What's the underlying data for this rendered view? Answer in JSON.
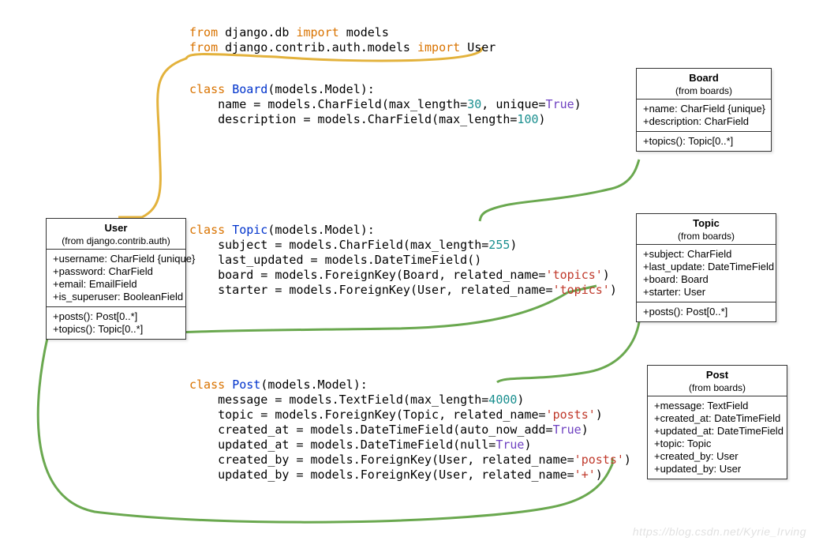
{
  "code": {
    "imports": [
      [
        {
          "t": "from ",
          "c": "kw-orange"
        },
        {
          "t": "django.db ",
          "c": ""
        },
        {
          "t": "import ",
          "c": "kw-orange"
        },
        {
          "t": "models",
          "c": ""
        }
      ],
      [
        {
          "t": "from ",
          "c": "kw-orange"
        },
        {
          "t": "django.contrib.auth.models ",
          "c": ""
        },
        {
          "t": "import ",
          "c": "kw-orange"
        },
        {
          "t": "User",
          "c": ""
        }
      ]
    ],
    "board": [
      [
        {
          "t": "class ",
          "c": "kw-orange"
        },
        {
          "t": "Board",
          "c": "kw-blue"
        },
        {
          "t": "(models.Model):",
          "c": ""
        }
      ],
      [
        {
          "t": "    name = models.CharField(max_length=",
          "c": ""
        },
        {
          "t": "30",
          "c": "kw-teal"
        },
        {
          "t": ", unique=",
          "c": ""
        },
        {
          "t": "True",
          "c": "kw-purple"
        },
        {
          "t": ")",
          "c": ""
        }
      ],
      [
        {
          "t": "    description = models.CharField(max_length=",
          "c": ""
        },
        {
          "t": "100",
          "c": "kw-teal"
        },
        {
          "t": ")",
          "c": ""
        }
      ]
    ],
    "topic": [
      [
        {
          "t": "class ",
          "c": "kw-orange"
        },
        {
          "t": "Topic",
          "c": "kw-blue"
        },
        {
          "t": "(models.Model):",
          "c": ""
        }
      ],
      [
        {
          "t": "    subject = models.CharField(max_length=",
          "c": ""
        },
        {
          "t": "255",
          "c": "kw-teal"
        },
        {
          "t": ")",
          "c": ""
        }
      ],
      [
        {
          "t": "    last_updated = models.DateTimeField()",
          "c": ""
        }
      ],
      [
        {
          "t": "    board = models.ForeignKey(Board, related_name=",
          "c": ""
        },
        {
          "t": "'topics'",
          "c": "str-red"
        },
        {
          "t": ")",
          "c": ""
        }
      ],
      [
        {
          "t": "    starter = models.ForeignKey(User, related_name=",
          "c": ""
        },
        {
          "t": "'topics'",
          "c": "str-red"
        },
        {
          "t": ")",
          "c": ""
        }
      ]
    ],
    "post": [
      [
        {
          "t": "class ",
          "c": "kw-orange"
        },
        {
          "t": "Post",
          "c": "kw-blue"
        },
        {
          "t": "(models.Model):",
          "c": ""
        }
      ],
      [
        {
          "t": "    message = models.TextField(max_length=",
          "c": ""
        },
        {
          "t": "4000",
          "c": "kw-teal"
        },
        {
          "t": ")",
          "c": ""
        }
      ],
      [
        {
          "t": "    topic = models.ForeignKey(Topic, related_name=",
          "c": ""
        },
        {
          "t": "'posts'",
          "c": "str-red"
        },
        {
          "t": ")",
          "c": ""
        }
      ],
      [
        {
          "t": "    created_at = models.DateTimeField(auto_now_add=",
          "c": ""
        },
        {
          "t": "True",
          "c": "kw-purple"
        },
        {
          "t": ")",
          "c": ""
        }
      ],
      [
        {
          "t": "    updated_at = models.DateTimeField(null=",
          "c": ""
        },
        {
          "t": "True",
          "c": "kw-purple"
        },
        {
          "t": ")",
          "c": ""
        }
      ],
      [
        {
          "t": "    created_by = models.ForeignKey(User, related_name=",
          "c": ""
        },
        {
          "t": "'posts'",
          "c": "str-red"
        },
        {
          "t": ")",
          "c": ""
        }
      ],
      [
        {
          "t": "    updated_by = models.ForeignKey(User, related_name=",
          "c": ""
        },
        {
          "t": "'+'",
          "c": "str-red"
        },
        {
          "t": ")",
          "c": ""
        }
      ]
    ]
  },
  "uml": {
    "user": {
      "name": "User",
      "from": "(from django.contrib.auth)",
      "attrs": [
        "+username: CharField {unique}",
        "+password: CharField",
        "+email: EmailField",
        "+is_superuser: BooleanField"
      ],
      "ops": [
        "+posts(): Post[0..*]",
        "+topics(): Topic[0..*]"
      ]
    },
    "board": {
      "name": "Board",
      "from": "(from boards)",
      "attrs": [
        "+name: CharField {unique}",
        "+description: CharField"
      ],
      "ops": [
        "+topics(): Topic[0..*]"
      ]
    },
    "topic": {
      "name": "Topic",
      "from": "(from boards)",
      "attrs": [
        "+subject: CharField",
        "+last_update: DateTimeField",
        "+board: Board",
        "+starter: User"
      ],
      "ops": [
        "+posts(): Post[0..*]"
      ]
    },
    "post": {
      "name": "Post",
      "from": "(from boards)",
      "attrs": [
        "+message: TextField",
        "+created_at: DateTimeField",
        "+updated_at: DateTimeField",
        "+topic: Topic",
        "+created_by: User",
        "+updated_by: User"
      ],
      "ops": []
    }
  },
  "watermark": "https://blog.csdn.net/Kyrie_Irving"
}
